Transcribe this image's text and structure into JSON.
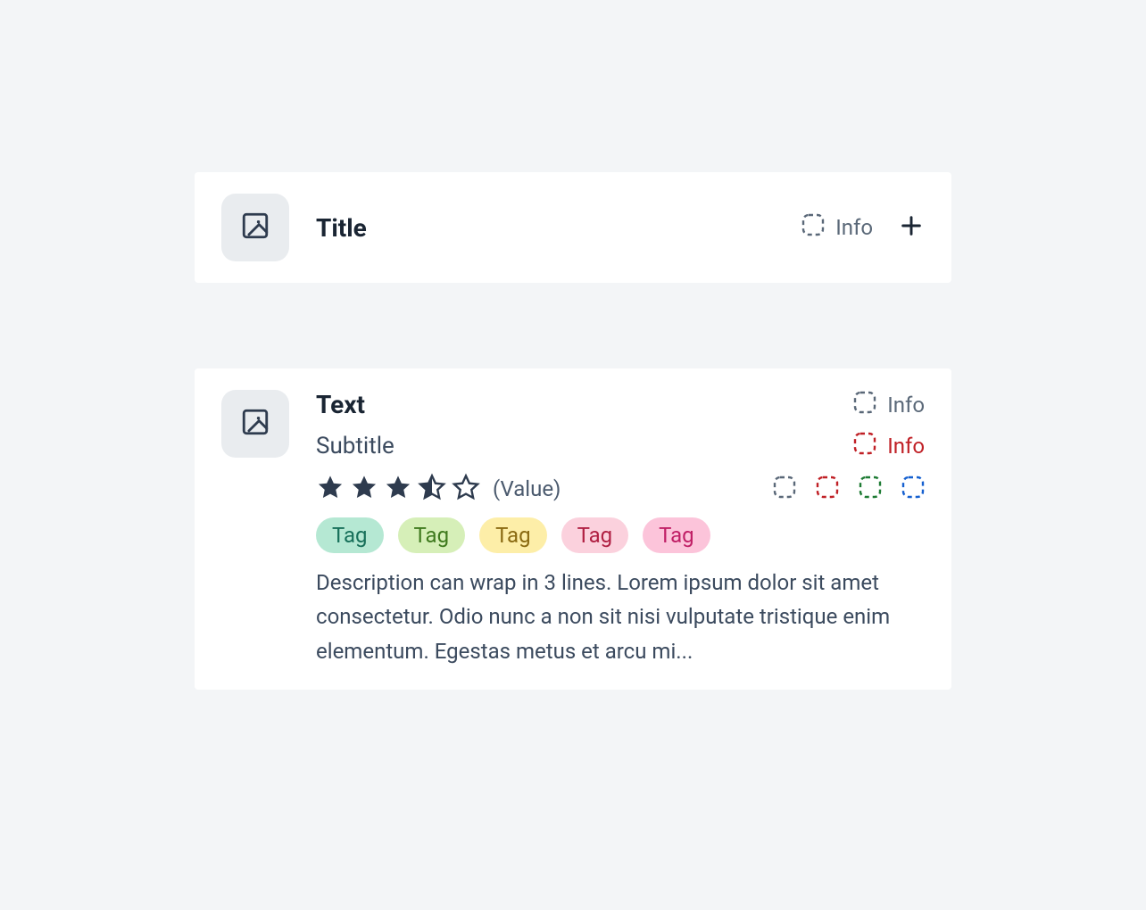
{
  "colors": {
    "dark": "#2e3b4e",
    "gray": "#5a6878",
    "red": "#c02026",
    "green": "#1e7b34",
    "blue": "#1560d0"
  },
  "card1": {
    "title": "Title",
    "info_label": "Info"
  },
  "card2": {
    "title": "Text",
    "subtitle": "Subtitle",
    "info1_label": "Info",
    "info2_label": "Info",
    "rating_value": "(Value)",
    "tags": [
      {
        "label": "Tag",
        "bg": "#b5e8d3",
        "fg": "#17705a"
      },
      {
        "label": "Tag",
        "bg": "#d6efb8",
        "fg": "#3f7a1e"
      },
      {
        "label": "Tag",
        "bg": "#fdeea8",
        "fg": "#8a6a12"
      },
      {
        "label": "Tag",
        "bg": "#fbd1dd",
        "fg": "#b02043"
      },
      {
        "label": "Tag",
        "bg": "#fcc4da",
        "fg": "#c01f66"
      }
    ],
    "description": "Description can wrap in 3 lines. Lorem ipsum dolor sit amet consectetur. Odio nunc a non sit nisi vulputate tristique enim elementum. Egestas metus et arcu mi..."
  }
}
